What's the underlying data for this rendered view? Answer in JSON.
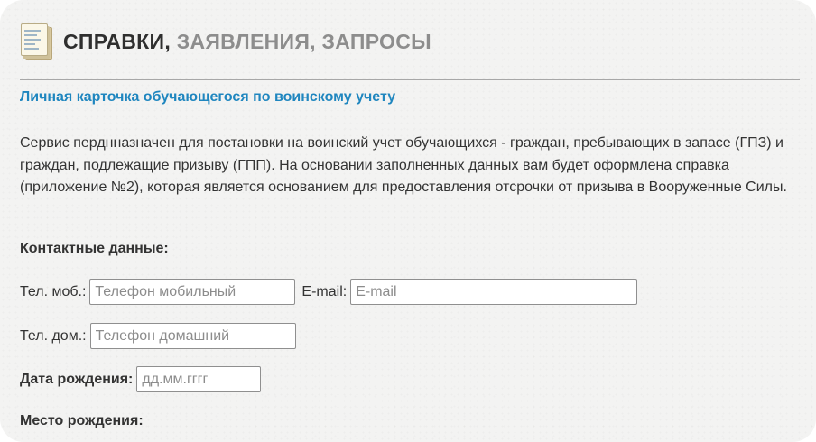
{
  "header": {
    "title_strong": "СПРАВКИ,",
    "title_muted": " ЗАЯВЛЕНИЯ, ЗАПРОСЫ",
    "icon": "document-stack-icon"
  },
  "subtitle": "Личная карточка обучающегося по воинскому учету",
  "description": "Сервис перднназначен для постановки на воинский учет обучающихся - граждан, пребывающих в запасе (ГПЗ) и граждан, подлежащие призыву (ГПП). На основании заполненных данных вам будет оформлена справка (приложение №2), которая является основанием для предоставления отсрочки от призыва в Вооруженные Силы.",
  "contacts": {
    "section_label": "Контактные данные:",
    "mobile_label": "Тел. моб.:",
    "mobile_placeholder": "Телефон мобильный",
    "mobile_value": "",
    "email_label": "E-mail:",
    "email_placeholder": "E-mail",
    "email_value": "",
    "home_label": "Тел. дом.:",
    "home_placeholder": "Телефон домашний",
    "home_value": ""
  },
  "birth": {
    "date_label": "Дата рождения:",
    "date_placeholder": "дд.мм.гггг",
    "date_value": "",
    "place_label": "Место рождения:"
  },
  "colors": {
    "accent": "#1f86bf",
    "title_muted": "#8d8d8d",
    "text": "#333333"
  }
}
